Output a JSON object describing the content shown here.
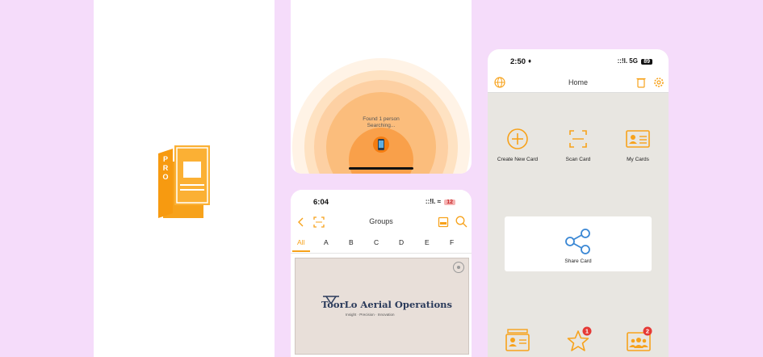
{
  "search_screen": {
    "found_text": "Found 1 person",
    "searching_text": "Searching..."
  },
  "groups_screen": {
    "status": {
      "time": "6:04",
      "signal": "::!l.",
      "battery": "12"
    },
    "title": "Groups",
    "alphabet": [
      "All",
      "A",
      "B",
      "C",
      "D",
      "E",
      "F"
    ],
    "card": {
      "company_name": "ToorLo Aerial Operations",
      "tagline": "Insight · Precision · Innovation"
    }
  },
  "home_screen": {
    "status": {
      "time": "2:50",
      "network": "5G",
      "battery": "89"
    },
    "title": "Home",
    "items": {
      "create": "Create New Card",
      "scan": "Scan Card",
      "my_cards": "My Cards",
      "share": "Share Card"
    },
    "badges": {
      "favorites": "1",
      "contacts": "2"
    }
  },
  "colors": {
    "accent": "#f7a21b",
    "background": "#f5dcfa",
    "home_bg": "#e8e6e1",
    "badge": "#e53935"
  }
}
